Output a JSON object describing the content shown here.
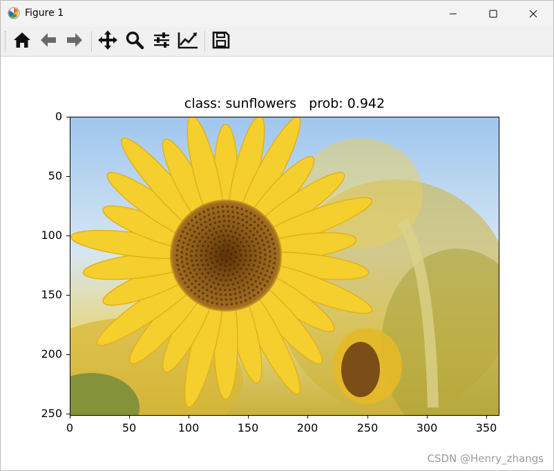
{
  "window": {
    "title": "Figure 1",
    "app_icon": "matplotlib-icon",
    "controls": [
      "minimize-icon",
      "maximize-icon",
      "close-icon"
    ]
  },
  "toolbar": {
    "buttons": [
      {
        "icon": "home-icon",
        "tooltip": "Reset original view"
      },
      {
        "icon": "back-arrow-icon",
        "tooltip": "Back to previous view"
      },
      {
        "icon": "forward-arrow-icon",
        "tooltip": "Forward to next view"
      },
      {
        "icon": "pan-icon",
        "tooltip": "Pan axes"
      },
      {
        "icon": "zoom-icon",
        "tooltip": "Zoom to rectangle"
      },
      {
        "icon": "subplots-icon",
        "tooltip": "Configure subplots"
      },
      {
        "icon": "edit-axis-icon",
        "tooltip": "Edit axis, curve and image parameters"
      },
      {
        "icon": "save-icon",
        "tooltip": "Save the figure"
      }
    ]
  },
  "figure": {
    "title": "class: sunflowers   prob: 0.942",
    "image": "sunflower-photo"
  },
  "axes": {
    "y_ticks": [
      "0",
      "50",
      "100",
      "150",
      "200",
      "250"
    ],
    "x_ticks": [
      "0",
      "50",
      "100",
      "150",
      "200",
      "250",
      "300",
      "350"
    ],
    "x_range": [
      0,
      360
    ],
    "y_range": [
      0,
      250
    ]
  },
  "watermark": "CSDN @Henry_zhangs",
  "colors": {
    "sky": "#bcd7ef",
    "petal": "#f2cc2b",
    "center": "#7a4a12"
  }
}
